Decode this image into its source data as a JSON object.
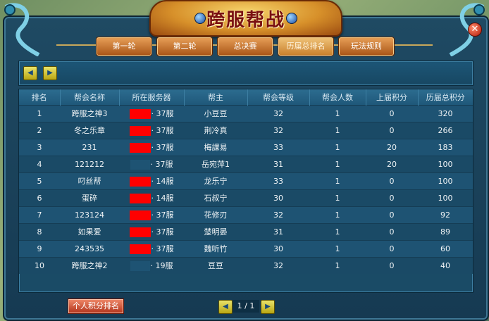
{
  "window": {
    "title": "跨服帮战",
    "close_symbol": "✕"
  },
  "tabs": [
    {
      "label": "第一轮",
      "active": false
    },
    {
      "label": "第二轮",
      "active": false
    },
    {
      "label": "总决赛",
      "active": false
    },
    {
      "label": "历届总排名",
      "active": true
    },
    {
      "label": "玩法规则",
      "active": false
    }
  ],
  "toolbar": {
    "prev_icon": "left-arrow",
    "next_icon": "right-arrow",
    "prev_symbol": "◀",
    "next_symbol": "▶"
  },
  "table": {
    "headers": [
      "排名",
      "帮会名称",
      "所在服务器",
      "帮主",
      "帮会等级",
      "帮会人数",
      "上届积分",
      "历届总积分"
    ],
    "rows": [
      {
        "rank": "1",
        "guild": "跨服之神3",
        "server": "· 37服",
        "leader": "小豆豆",
        "level": "32",
        "members": "1",
        "last_score": "0",
        "total_score": "320"
      },
      {
        "rank": "2",
        "guild": "冬之乐章",
        "server": "· 37服",
        "leader": "荆冷真",
        "level": "32",
        "members": "1",
        "last_score": "0",
        "total_score": "266"
      },
      {
        "rank": "3",
        "guild": "231",
        "server": "· 37服",
        "leader": "梅課易",
        "level": "33",
        "members": "1",
        "last_score": "20",
        "total_score": "183"
      },
      {
        "rank": "4",
        "guild": "121212",
        "server": "· 37服",
        "leader": "岳宛萍1",
        "level": "31",
        "members": "1",
        "last_score": "20",
        "total_score": "100"
      },
      {
        "rank": "5",
        "guild": "叼丝帮",
        "server": "· 14服",
        "leader": "龙乐宁",
        "level": "33",
        "members": "1",
        "last_score": "0",
        "total_score": "100"
      },
      {
        "rank": "6",
        "guild": "蛋碎",
        "server": "· 14服",
        "leader": "石叔宁",
        "level": "30",
        "members": "1",
        "last_score": "0",
        "total_score": "100"
      },
      {
        "rank": "7",
        "guild": "123124",
        "server": "· 37服",
        "leader": "花修刃",
        "level": "32",
        "members": "1",
        "last_score": "0",
        "total_score": "92"
      },
      {
        "rank": "8",
        "guild": "如果爱",
        "server": "· 37服",
        "leader": "楚明晏",
        "level": "31",
        "members": "1",
        "last_score": "0",
        "total_score": "89"
      },
      {
        "rank": "9",
        "guild": "243535",
        "server": "· 37服",
        "leader": "魏听竹",
        "level": "30",
        "members": "1",
        "last_score": "0",
        "total_score": "60"
      },
      {
        "rank": "10",
        "guild": "跨服之神2",
        "server": "· 19服",
        "leader": "豆豆",
        "level": "32",
        "members": "1",
        "last_score": "0",
        "total_score": "40"
      }
    ]
  },
  "footer": {
    "personal_rank_button": "个人积分排名",
    "page_indicator": "1 / 1",
    "prev_symbol": "◀",
    "next_symbol": "▶"
  },
  "colors": {
    "redaction": "#ff0000",
    "accent_gold": "#d7902a",
    "panel_blue": "#1a4b66"
  }
}
